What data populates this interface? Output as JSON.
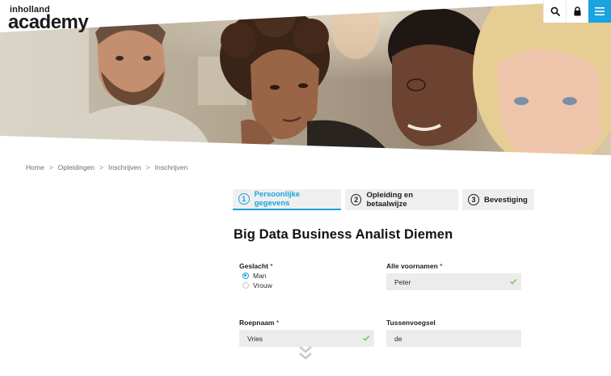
{
  "brand": {
    "top": "inholland",
    "main": "academy"
  },
  "header_actions": {
    "search_icon": "search-icon",
    "lock_icon": "lock-icon",
    "menu_icon": "hamburger-menu-icon",
    "accent_color": "#1aa3e0"
  },
  "breadcrumb": {
    "items": [
      "Home",
      "Opleidingen",
      "Inschrijven",
      "Inschrijven"
    ],
    "separator": ">"
  },
  "steps": [
    {
      "number": "1",
      "label": "Persoonlijke gegevens",
      "active": true
    },
    {
      "number": "2",
      "label": "Opleiding en betaalwijze",
      "active": false
    },
    {
      "number": "3",
      "label": "Bevestiging",
      "active": false
    }
  ],
  "page_title": "Big Data Business Analist Diemen",
  "form": {
    "gender": {
      "label": "Geslacht",
      "required_mark": "*",
      "options": [
        "Man",
        "Vrouw"
      ],
      "selected": "Man"
    },
    "first_names": {
      "label": "Alle voornamen",
      "required_mark": "*",
      "value": "Peter",
      "valid": true
    },
    "call_name": {
      "label": "Roepnaam",
      "required_mark": "*",
      "value": "Vries",
      "valid": true
    },
    "infix": {
      "label": "Tussenvoegsel",
      "value": "de"
    }
  },
  "colors": {
    "accent": "#1aa3e0",
    "valid_check": "#6cc24a",
    "field_bg": "#ececec"
  }
}
